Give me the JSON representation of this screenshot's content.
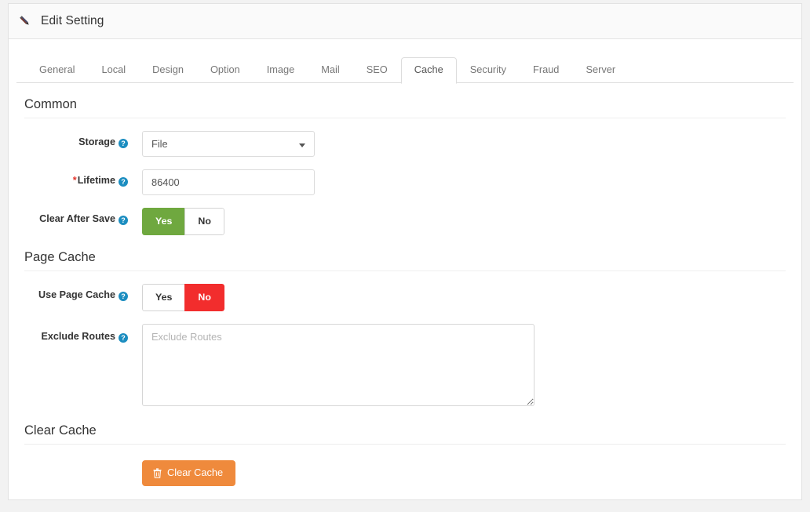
{
  "header": {
    "title": "Edit Setting",
    "icon": "pencil-icon"
  },
  "tabs": [
    {
      "label": "General",
      "active": false
    },
    {
      "label": "Local",
      "active": false
    },
    {
      "label": "Design",
      "active": false
    },
    {
      "label": "Option",
      "active": false
    },
    {
      "label": "Image",
      "active": false
    },
    {
      "label": "Mail",
      "active": false
    },
    {
      "label": "SEO",
      "active": false
    },
    {
      "label": "Cache",
      "active": true
    },
    {
      "label": "Security",
      "active": false
    },
    {
      "label": "Fraud",
      "active": false
    },
    {
      "label": "Server",
      "active": false
    }
  ],
  "sections": {
    "common": {
      "title": "Common",
      "storage": {
        "label": "Storage",
        "help": "?",
        "value": "File",
        "options": [
          "File"
        ]
      },
      "lifetime": {
        "label": "Lifetime",
        "required": "*",
        "help": "?",
        "value": "86400",
        "placeholder": "Lifetime"
      },
      "clear_after_save": {
        "label": "Clear After Save",
        "help": "?",
        "yes": "Yes",
        "no": "No",
        "selected": "Yes"
      }
    },
    "page_cache": {
      "title": "Page Cache",
      "use_page_cache": {
        "label": "Use Page Cache",
        "help": "?",
        "yes": "Yes",
        "no": "No",
        "selected": "No"
      },
      "exclude_routes": {
        "label": "Exclude Routes",
        "help": "?",
        "value": "",
        "placeholder": "Exclude Routes"
      }
    },
    "clear_cache": {
      "title": "Clear Cache",
      "button": {
        "label": "Clear Cache",
        "icon": "trash-icon"
      }
    }
  },
  "colors": {
    "yes_active": "#6fa83f",
    "no_active": "#f22d2d",
    "clear_button": "#ef8a3c",
    "help_icon": "#1b8dc0",
    "required_asterisk": "#e2342b"
  }
}
